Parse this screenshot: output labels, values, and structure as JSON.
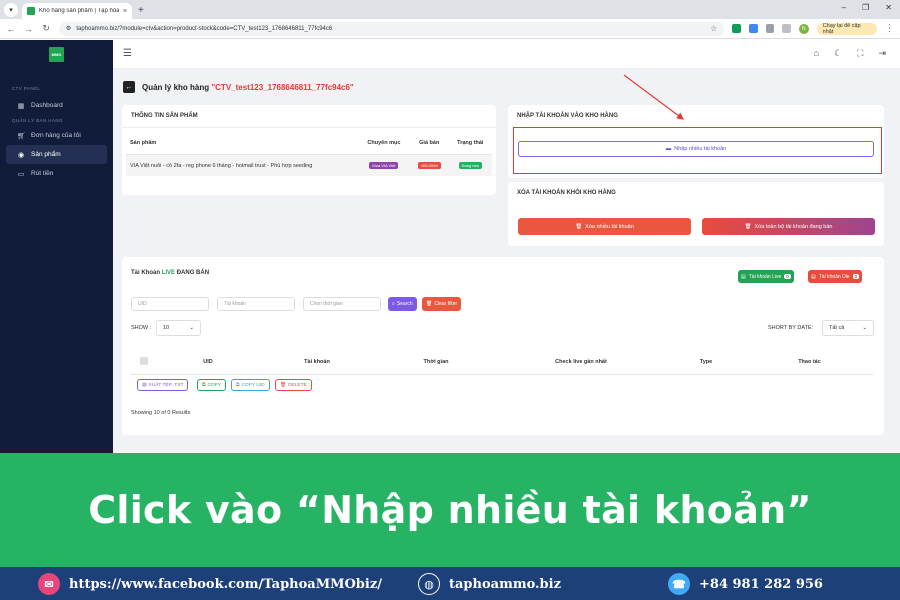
{
  "browser": {
    "tab_title": "Kho hàng sản phẩm | Tạp hóa",
    "url": "taphoammo.biz/?module=ctv&action=product-stock&code=CTV_test123_1768646811_77fc94c6",
    "update_label": "Chạy lại để cập nhật",
    "profile_initial": "N"
  },
  "sidebar": {
    "logo_text": "MMO",
    "section_panel": "CTV PANEL",
    "section_manage": "QUẢN LÝ BÁN HÀNG",
    "items": [
      {
        "label": "Dashboard"
      },
      {
        "label": "Đơn hàng của tôi"
      },
      {
        "label": "Sản phẩm"
      },
      {
        "label": "Rút tiền"
      }
    ]
  },
  "page": {
    "title_prefix": "Quản lý kho hàng",
    "title_code": "\"CTV_test123_1768646811_77fc94c6\""
  },
  "product_info": {
    "title": "THÔNG TIN SẢN PHẨM",
    "headers": [
      "Sản phẩm",
      "Chuyên mục",
      "Giá bán",
      "Trạng thái"
    ],
    "row": {
      "name": "VIA Việt nuôi - có 2fa - reg phone 6 tháng - hotmail trust - Phù hợp seeding",
      "category": "Mua VIA Việt",
      "price": "105.000đ",
      "status": "Đang bán"
    }
  },
  "import_card": {
    "title": "NHẬP TÀI KHOẢN VÀO KHO HÀNG",
    "button": "Nhập nhiều tài khoản"
  },
  "delete_card": {
    "title": "XÓA TÀI KHOẢN KHỎI KHO HÀNG",
    "btn_delete_many": "Xóa nhiều tài khoản",
    "btn_delete_all": "Xóa toàn bộ tài khoản đang bán"
  },
  "accounts": {
    "title_prefix": "Tài Khoản",
    "title_live": "LIVE",
    "title_suffix": "ĐANG BÁN",
    "live_btn": "Tài khoản Live",
    "live_count": "0",
    "die_btn": "Tài khoản Die",
    "die_count": "0",
    "filters": {
      "uid_placeholder": "UID",
      "account_placeholder": "Tài khoản",
      "time_placeholder": "Chọn thời gian",
      "search": "Search",
      "clear": "Clear filter"
    },
    "show_label": "SHOW :",
    "show_value": "10",
    "sort_label": "SHORT BY DATE:",
    "sort_value": "Tất cả",
    "headers": [
      "UID",
      "Tài khoản",
      "Thời gian",
      "Check live gần nhất",
      "Type",
      "Thao tác"
    ],
    "tools": {
      "export": "XUẤT TỆP .TXT",
      "copy": "COPY",
      "copy_uid": "COPY UID",
      "delete": "DELETE"
    },
    "showing": "Showing 10 of 0 Results"
  },
  "overlay": {
    "instruction": "Click vào “Nhập nhiều tài khoản”",
    "facebook": "https://www.facebook.com/TaphoaMMObiz/",
    "website": "taphoammo.biz",
    "phone": "+84 981 282 956"
  },
  "colors": {
    "sidebar_bg": "#111c3a",
    "banner_green": "#26b364",
    "footer_blue": "#1e4079",
    "highlight_red": "#e53935"
  }
}
